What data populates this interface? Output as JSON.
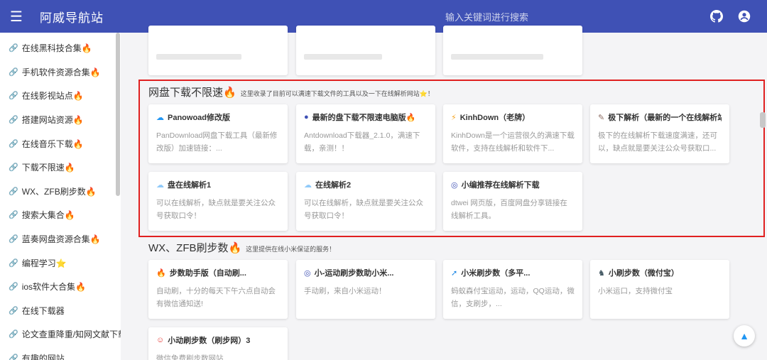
{
  "header": {
    "title": "阿威导航站",
    "search_placeholder": "输入关键词进行搜索"
  },
  "sidebar": {
    "items": [
      {
        "label": "在线黑科技合集🔥"
      },
      {
        "label": "手机软件资源合集🔥"
      },
      {
        "label": "在线影视站点🔥"
      },
      {
        "label": "搭建网站资源🔥"
      },
      {
        "label": "在线音乐下载🔥"
      },
      {
        "label": "下载不限速🔥"
      },
      {
        "label": "WX、ZFB刷步数🔥"
      },
      {
        "label": "搜索大集合🔥"
      },
      {
        "label": "蓝奏网盘资源合集🔥"
      },
      {
        "label": "编程学习⭐"
      },
      {
        "label": "ios软件大合集🔥"
      },
      {
        "label": "在线下载器"
      },
      {
        "label": "论文查重降重/知网文献下载"
      },
      {
        "label": "有趣的网站"
      }
    ]
  },
  "sections": {
    "pan": {
      "title": "网盘下载不限速🔥",
      "subtitle": "这里收录了目前可以满速下载文件的工具以及一下在线解析网站⭐！",
      "cards": [
        {
          "icon": "☁",
          "icon_color": "#2196f3",
          "title": "Panowoad修改版",
          "desc": "PanDownload网盘下载工具（最新修改版）加速链接：..."
        },
        {
          "icon": "●",
          "icon_color": "#3f51b5",
          "title": "最新的盘下载不限速电脑版🔥",
          "desc": "Antdownload下载器_2.1.0，满速下载，亲测！！"
        },
        {
          "icon": "⚡",
          "icon_color": "#f5a623",
          "title": "KinhDown（老牌）",
          "desc": "KinhDown是一个运营很久的满速下载软件，支持在线解析和软件下..."
        },
        {
          "icon": "✎",
          "icon_color": "#8d6e63",
          "title": "极下解析（最新的一个在线解析站）",
          "desc": "极下的在线解析下载速度满速，还可以，缺点就是要关注公众号获取口..."
        },
        {
          "icon": "☁",
          "icon_color": "#90caf9",
          "title": "盘在线解析1",
          "desc": "可以在线解析，缺点就是要关注公众号获取口令！"
        },
        {
          "icon": "☁",
          "icon_color": "#90caf9",
          "title": "在线解析2",
          "desc": "可以在线解析，缺点就是要关注公众号获取口令！"
        },
        {
          "icon": "◎",
          "icon_color": "#3f51b5",
          "title": "小编推荐在线解析下载",
          "desc": "dtwei 网页版，百度网盘分享链接在线解析工具。"
        }
      ]
    },
    "steps": {
      "title": "WX、ZFB刷步数🔥",
      "subtitle": "这里提供在线小米保证的服务！",
      "cards": [
        {
          "icon": "🔥",
          "icon_color": "#ff6d00",
          "title": "步数助手版（自动刷...",
          "desc": "自动刷，十分的每天下午六点自动会有微信通知送!"
        },
        {
          "icon": "◎",
          "icon_color": "#3f51b5",
          "title": "小-运动刷步数助小米...",
          "desc": "手动刷，来自小米运动！"
        },
        {
          "icon": "➚",
          "icon_color": "#1e88e5",
          "title": "小米刷步数（多平...",
          "desc": "蚂蚁森付宝运动，运动，QQ运动，微信，支刷步，..."
        },
        {
          "icon": "♞",
          "icon_color": "#455a64",
          "title": "小刷步数（微付宝）",
          "desc": "小米运口，支持微付宝"
        },
        {
          "icon": "☺",
          "icon_color": "#e53935",
          "title": "小动刷步数（刷步网）3",
          "desc": "微信免费刷步数网站"
        }
      ]
    },
    "top_row": {
      "cards": [
        {
          "title": ""
        },
        {
          "title": ""
        },
        {
          "title": ""
        }
      ]
    }
  },
  "fab": {
    "label": "▲"
  }
}
